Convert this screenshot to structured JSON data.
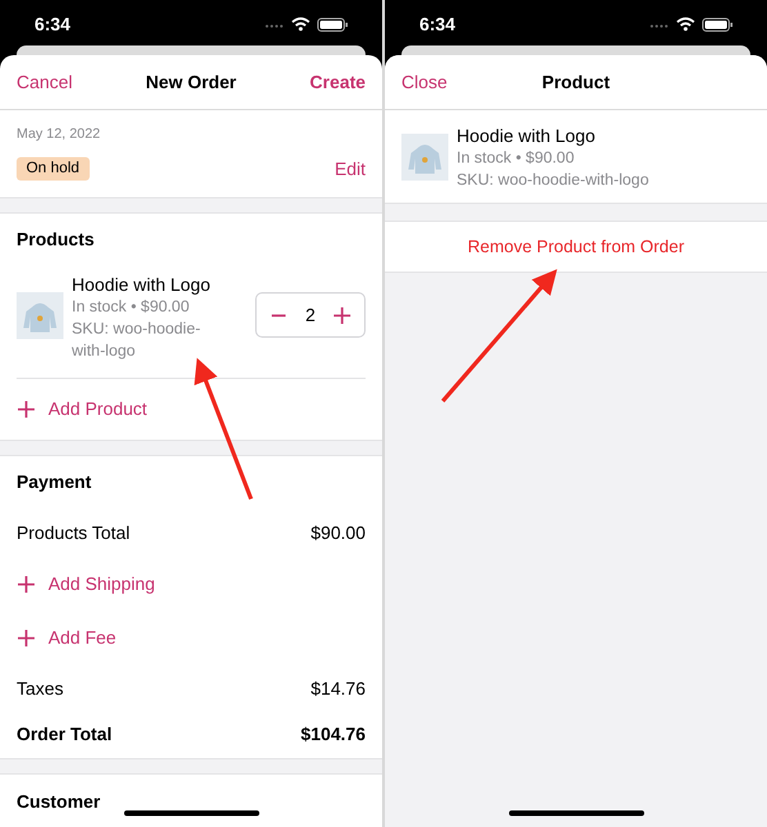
{
  "new_order_screen": {
    "status_bar": {
      "time": "6:34"
    },
    "nav": {
      "left": "Cancel",
      "title": "New Order",
      "right": "Create"
    },
    "order_info": {
      "date": "May 12, 2022",
      "status": "On hold",
      "edit": "Edit"
    },
    "products": {
      "title": "Products",
      "items": [
        {
          "name": "Hoodie with Logo",
          "stock": "In stock • $90.00",
          "sku": "SKU: woo-hoodie-with-logo",
          "quantity": "2"
        }
      ],
      "add": "Add Product"
    },
    "payment": {
      "title": "Payment",
      "rows": [
        {
          "kind": "amount",
          "label": "Products Total",
          "value": "$90.00",
          "bold": false
        },
        {
          "kind": "action",
          "label": "Add Shipping"
        },
        {
          "kind": "action",
          "label": "Add Fee"
        },
        {
          "kind": "amount",
          "label": "Taxes",
          "value": "$14.76",
          "bold": false
        },
        {
          "kind": "amount",
          "label": "Order Total",
          "value": "$104.76",
          "bold": true
        }
      ]
    },
    "customer": {
      "title": "Customer"
    }
  },
  "product_screen": {
    "status_bar": {
      "time": "6:34"
    },
    "nav": {
      "left": "Close",
      "title": "Product"
    },
    "product": {
      "name": "Hoodie with Logo",
      "stock": "In stock • $90.00",
      "sku": "SKU: woo-hoodie-with-logo"
    },
    "remove": "Remove Product from Order"
  }
}
